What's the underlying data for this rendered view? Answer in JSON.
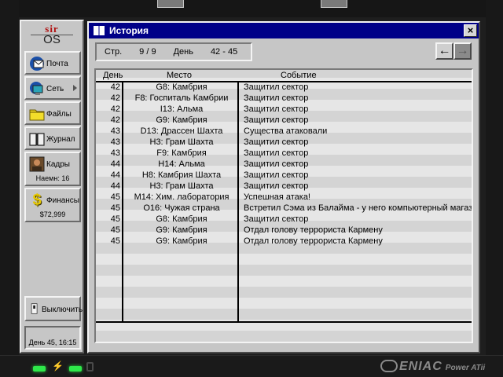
{
  "os_logo": {
    "line1": "sir",
    "line2": "OS"
  },
  "sidebar": {
    "items": [
      {
        "label": "Почта",
        "icon": "mail-icon"
      },
      {
        "label": "Сеть",
        "icon": "network-icon"
      },
      {
        "label": "Файлы",
        "icon": "folder-icon"
      },
      {
        "label": "Журнал",
        "icon": "journal-icon"
      },
      {
        "label": "Кадры",
        "icon": "personnel-icon",
        "sub": "Наемн: 16"
      },
      {
        "label": "Финансы",
        "icon": "dollar-icon",
        "sub": "$72,999"
      }
    ],
    "shutdown_label": "Выключить",
    "status": "День 45, 16:15"
  },
  "window": {
    "title": "История",
    "close_glyph": "×",
    "page_label": "Стр.",
    "page_value": "9 / 9",
    "day_label": "День",
    "day_range": "42 - 45",
    "nav_prev": "←",
    "nav_next": "→"
  },
  "table": {
    "columns": [
      "День",
      "Место",
      "Событие"
    ],
    "rows": [
      {
        "day": "42",
        "place": "G8: Камбрия",
        "event": "Защитил сектор"
      },
      {
        "day": "42",
        "place": "F8: Госпиталь Камбрии",
        "event": "Защитил сектор"
      },
      {
        "day": "42",
        "place": "I13: Альма",
        "event": "Защитил сектор"
      },
      {
        "day": "42",
        "place": "G9: Камбрия",
        "event": "Защитил сектор"
      },
      {
        "day": "43",
        "place": "D13: Драссен Шахта",
        "event": "Существа атаковали"
      },
      {
        "day": "43",
        "place": "H3: Грам Шахта",
        "event": "Защитил сектор"
      },
      {
        "day": "43",
        "place": "F9: Камбрия",
        "event": "Защитил сектор"
      },
      {
        "day": "44",
        "place": "H14: Альма",
        "event": "Защитил сектор"
      },
      {
        "day": "44",
        "place": "H8: Камбрия Шахта",
        "event": "Защитил сектор"
      },
      {
        "day": "44",
        "place": "H3: Грам Шахта",
        "event": "Защитил сектор"
      },
      {
        "day": "45",
        "place": "M14: Хим. лаборатория",
        "event": "Успешная атака!"
      },
      {
        "day": "45",
        "place": "O16: Чужая страна",
        "event": "Встретил Сэма из Балайма - у него компьютерный магазин"
      },
      {
        "day": "45",
        "place": "G8: Камбрия",
        "event": "Защитил сектор"
      },
      {
        "day": "45",
        "place": "G9: Камбрия",
        "event": "Отдал голову террориста Кармену"
      },
      {
        "day": "45",
        "place": "G9: Камбрия",
        "event": "Отдал голову террориста Кармену"
      }
    ]
  },
  "device": {
    "brand": "ENIAC",
    "model": "Power ATii"
  },
  "colors": {
    "titlebar": "#000088",
    "panel": "#c6c6c6",
    "logo_red": "#b01010",
    "led": "#2ee84a"
  }
}
